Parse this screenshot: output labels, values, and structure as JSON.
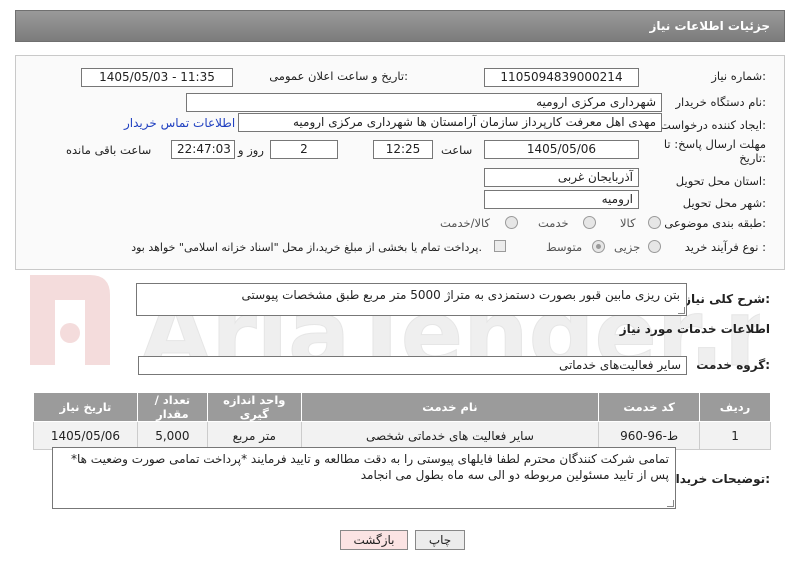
{
  "header": {
    "title": "جزئیات اطلاعات نیاز"
  },
  "form": {
    "need_number_label": "شماره نیاز:",
    "need_number": "1105094839000214",
    "announce_label": "تاریخ و ساعت اعلان عمومی:",
    "announce_value": "1405/05/03 - 11:35",
    "buyer_org_label": "نام دستگاه خریدار:",
    "buyer_org": "شهرداری مرکزی ارومیه",
    "creator_label": "ایجاد کننده درخواست:",
    "creator": "مهدی اهل معرفت کارپرداز سازمان آرامستان ها شهرداری مرکزی ارومیه",
    "contact_link": "اطلاعات تماس خریدار",
    "deadline_label_1": "مهلت ارسال پاسخ: تا",
    "deadline_label_2": "تاریخ:",
    "deadline_date": "1405/05/06",
    "time_label": "ساعت",
    "deadline_time": "12:25",
    "days_value": "2",
    "days_label": "روز و",
    "remaining_time": "22:47:03",
    "remaining_label": "ساعت باقی مانده",
    "province_label": "استان محل تحویل:",
    "province": "آذربایجان غربی",
    "city_label": "شهر محل تحویل:",
    "city": "ارومیه",
    "category_label": "طبقه بندی موضوعی:",
    "category_options": [
      "کالا",
      "خدمت",
      "کالا/خدمت"
    ],
    "process_label": "نوع فرآیند خرید :",
    "process_options": [
      "جزیی",
      "متوسط"
    ],
    "payment_note": "پرداخت تمام یا بخشی از مبلغ خرید،از محل \"اسناد خزانه اسلامی\" خواهد بود."
  },
  "summary": {
    "label": "شرح کلی نیاز:",
    "text": "بتن ریزی مابین قبور بصورت دستمزدی به متراژ 5000 متر مربع طبق مشخصات پیوستی"
  },
  "services": {
    "section_title": "اطلاعات خدمات مورد نیاز",
    "group_label": "گروه خدمت:",
    "group_value": "سایر فعالیت‌های خدماتی",
    "table": {
      "headers": [
        "ردیف",
        "کد خدمت",
        "نام خدمت",
        "واحد اندازه گیری",
        "تعداد / مقدار",
        "تاریخ نیاز"
      ],
      "rows": [
        [
          "1",
          "ط-96-960",
          "سایر فعالیت های خدماتی شخصی",
          "متر مربع",
          "5,000",
          "1405/05/06"
        ]
      ]
    }
  },
  "buyer_notes": {
    "label": "توضیحات خریدار:",
    "text": "*تمامی شرکت کنندگان محترم لطفا فایلهای پیوستی را به دقت مطالعه و تایید فرمایند *پرداخت تمامی صورت وضعیت ها پس از تایید مسئولین مربوطه دو الی سه ماه بطول می انجامد"
  },
  "buttons": {
    "print": "چاپ",
    "back": "بازگشت"
  },
  "watermark": {
    "text": "AriaTender.net"
  }
}
